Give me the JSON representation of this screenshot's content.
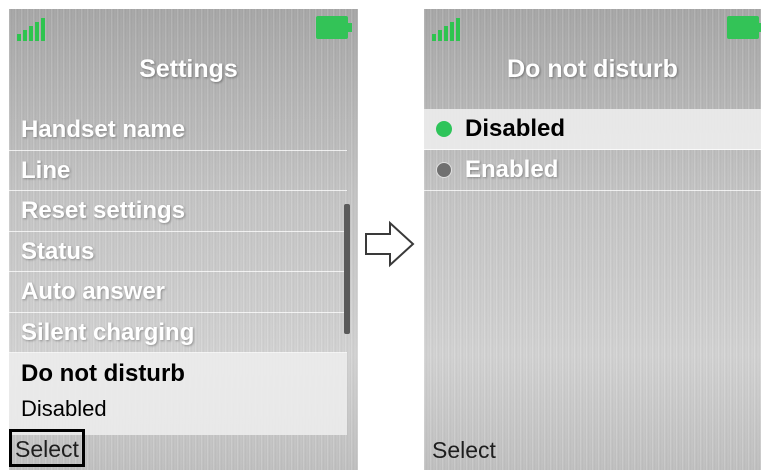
{
  "left_screen": {
    "title": "Settings",
    "menu_items": [
      {
        "label": "Handset name"
      },
      {
        "label": "Line"
      },
      {
        "label": "Reset settings"
      },
      {
        "label": "Status"
      },
      {
        "label": "Auto answer"
      },
      {
        "label": "Silent charging"
      }
    ],
    "selected_item": {
      "label": "Do not disturb",
      "value": "Disabled"
    },
    "softkey": "Select"
  },
  "right_screen": {
    "title": "Do not disturb",
    "options": [
      {
        "label": "Disabled",
        "selected": true
      },
      {
        "label": "Enabled",
        "selected": false
      }
    ],
    "softkey": "Select"
  },
  "colors": {
    "status_green": "#33c357",
    "selected_dot": "#2ec45a",
    "unselected_dot": "#707070"
  },
  "icons": {
    "signal": "signal-strength-icon",
    "battery": "battery-full-icon",
    "arrow": "right-arrow-icon"
  }
}
